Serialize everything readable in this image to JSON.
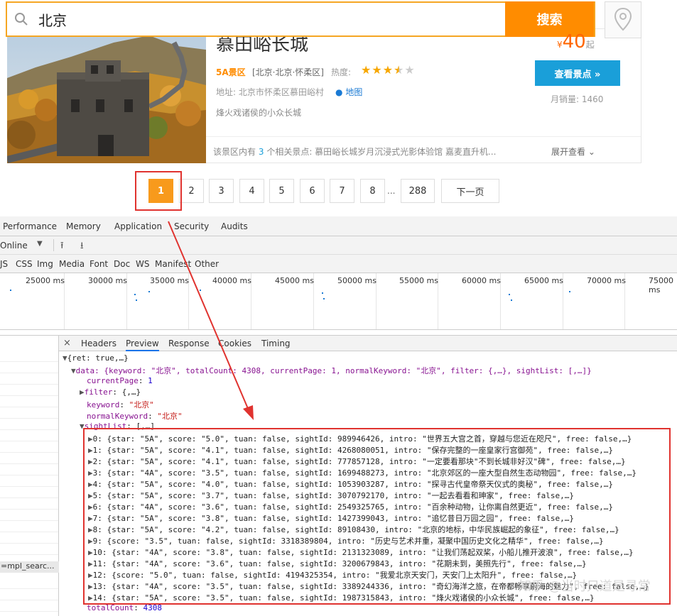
{
  "search": {
    "value": "北京",
    "button": "搜索"
  },
  "sight": {
    "title": "慕田峪长城",
    "level": "5A景区",
    "area": "[北京·北京·怀柔区]",
    "heat_label": "热度:",
    "rating": 3.5,
    "address": "地址: 北京市怀柔区慕田峪村",
    "map_label": "地图",
    "intro": "烽火戏诸侯的小众长城",
    "price_currency": "¥",
    "price": "40",
    "price_unit": "起",
    "view_button": "查看景点 »",
    "sales": "月销量: 1460",
    "related_prefix": "该景区内有",
    "related_count": "3",
    "related_suffix": "个相关景点: 慕田峪长城岁月沉浸式光影体验馆 嘉麦直升机...",
    "expand": "展开查看"
  },
  "pager": {
    "pages": [
      "1",
      "2",
      "3",
      "4",
      "5",
      "6",
      "7",
      "8"
    ],
    "ellipsis": "...",
    "last": "288",
    "next": "下一页",
    "current": "1"
  },
  "devtools": {
    "tabs": [
      "Performance",
      "Memory",
      "Application",
      "Security",
      "Audits"
    ],
    "throttle": "Online",
    "filters": [
      "JS",
      "CSS",
      "Img",
      "Media",
      "Font",
      "Doc",
      "WS",
      "Manifest",
      "Other"
    ],
    "ticks": [
      "25000 ms",
      "30000 ms",
      "35000 ms",
      "40000 ms",
      "45000 ms",
      "50000 ms",
      "55000 ms",
      "60000 ms",
      "65000 ms",
      "70000 ms",
      "75000 ms"
    ],
    "selected_request": "=mpl_searc...",
    "panel_tabs": [
      "Headers",
      "Preview",
      "Response",
      "Cookies",
      "Timing"
    ],
    "active_panel_tab": "Preview",
    "close": "×"
  },
  "json": {
    "root": "{ret: true,…}",
    "data_line": "data: {keyword: \"北京\", totalCount: 4308, currentPage: 1, normalKeyword: \"北京\", filter: {,…}, sightList: [,…]}",
    "currentPage_key": "currentPage",
    "currentPage_val": "1",
    "filter_key": "filter",
    "filter_val": "{,…}",
    "keyword_key": "keyword",
    "keyword_val": "\"北京\"",
    "normalKeyword_key": "normalKeyword",
    "normalKeyword_val": "\"北京\"",
    "sightList_key": "sightList",
    "sightList_val": "[,…]",
    "items": [
      "0: {star: \"5A\", score: \"5.0\", tuan: false, sightId: 989946426, intro: \"世界五大宫之首，穿越与您近在咫尺\", free: false,…}",
      "1: {star: \"5A\", score: \"4.1\", tuan: false, sightId: 4268080051, intro: \"保存完整的一座皇家行宫御苑\", free: false,…}",
      "2: {star: \"5A\", score: \"4.1\", tuan: false, sightId: 777857128, intro: \"一定要看那块\"不到长城非好汉\"碑\", free: false,…}",
      "3: {star: \"4A\", score: \"3.5\", tuan: false, sightId: 1699488273, intro: \"北京郊区的一座大型自然生态动物园\", free: false,…}",
      "4: {star: \"5A\", score: \"4.0\", tuan: false, sightId: 1053903287, intro: \"探寻古代皇帝祭天仪式的奥秘\", free: false,…}",
      "5: {star: \"5A\", score: \"3.7\", tuan: false, sightId: 3070792170, intro: \"一起去看看和珅家\", free: false,…}",
      "6: {star: \"4A\", score: \"3.6\", tuan: false, sightId: 2549325765, intro: \"百余种动物，让你离自然更近\", free: false,…}",
      "7: {star: \"5A\", score: \"3.8\", tuan: false, sightId: 1427399043, intro: \"追忆昔日万园之园\", free: false,…}",
      "8: {star: \"5A\", score: \"4.2\", tuan: false, sightId: 89108430, intro: \"北京的地标，中华民族崛起的象征\", free: false,…}",
      "9: {score: \"3.5\", tuan: false, sightId: 3318389804, intro: \"历史与艺术并重，凝聚中国历史文化之精华\", free: false,…}",
      "10: {star: \"4A\", score: \"3.8\", tuan: false, sightId: 2131323089, intro: \"让我们荡起双桨，小船儿推开波浪\", free: false,…}",
      "11: {star: \"4A\", score: \"3.6\", tuan: false, sightId: 3200679843, intro: \"花期未到，美照先行\", free: false,…}",
      "12: {score: \"5.0\", tuan: false, sightId: 4194325354, intro: \"我爱北京天安门，天安门上太阳升\", free: false,…}",
      "13: {star: \"4A\", score: \"3.5\", tuan: false, sightId: 3389244336, intro: \"奇幻海洋之旅，在帝都畅享蔚海的魅力\", free: false,…}",
      "14: {star: \"5A\", score: \"3.5\", tuan: false, sightId: 1987315843, intro: \"烽火戏诸侯的小众长城\", free: false,…}"
    ],
    "totalCount_key": "totalCount",
    "totalCount_val": "4308"
  },
  "watermark": "知乎 @当时只道是寻常",
  "colors": {
    "accent": "#ff8c00",
    "highlight": "#e0332f",
    "link": "#1a9fd9"
  }
}
